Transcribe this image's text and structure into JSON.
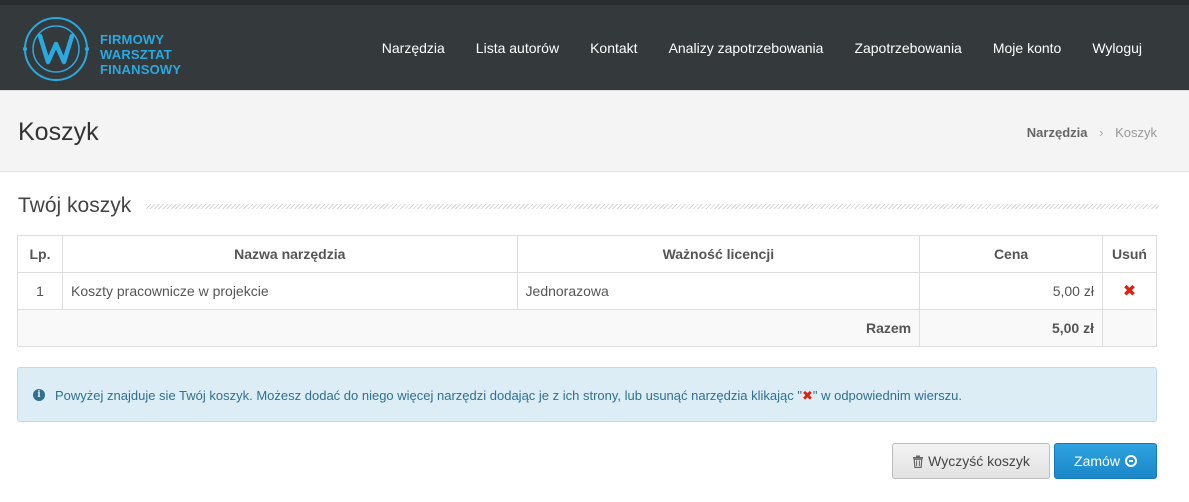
{
  "brand": {
    "line1": "FIRMOWY",
    "line2": "WARSZTAT",
    "line3": "FINANSOWY",
    "logo_icon": "w-circle-logo-icon",
    "color": "#2aa9e0"
  },
  "nav": {
    "items": [
      {
        "label": "Narzędzia"
      },
      {
        "label": "Lista autorów"
      },
      {
        "label": "Kontakt"
      },
      {
        "label": "Analizy zapotrzebowania"
      },
      {
        "label": "Zapotrzebowania"
      },
      {
        "label": "Moje konto"
      },
      {
        "label": "Wyloguj"
      }
    ]
  },
  "page": {
    "title": "Koszyk",
    "breadcrumb": {
      "parent": "Narzędzia",
      "separator": "›",
      "current": "Koszyk"
    },
    "section_title": "Twój koszyk"
  },
  "table": {
    "headers": {
      "lp": "Lp.",
      "name": "Nazwa narzędzia",
      "validity": "Ważność licencji",
      "price": "Cena",
      "delete": "Usuń"
    },
    "rows": [
      {
        "lp": "1",
        "name": "Koszty pracownicze w projekcie",
        "validity": "Jednorazowa",
        "price": "5,00 zł",
        "delete_icon": "✖"
      }
    ],
    "total_label": "Razem",
    "total_value": "5,00 zł"
  },
  "alert": {
    "icon": "i",
    "text_before": "Powyżej znajduje sie Twój koszyk. Możesz dodać do niego więcej narzędzi dodając je z ich strony, lub usunąć narzędzia klikając \"",
    "mark": "✖",
    "text_after": "\" w odpowiednim wierszu."
  },
  "buttons": {
    "clear_label": "Wyczyść koszyk",
    "clear_icon": "trash-icon",
    "order_label": "Zamów",
    "order_icon": "arrow-circle-icon"
  },
  "colors": {
    "topbar": "#34393c",
    "accent": "#2aa9e0",
    "danger": "#d9230f",
    "alert_bg": "#dcedf6"
  }
}
